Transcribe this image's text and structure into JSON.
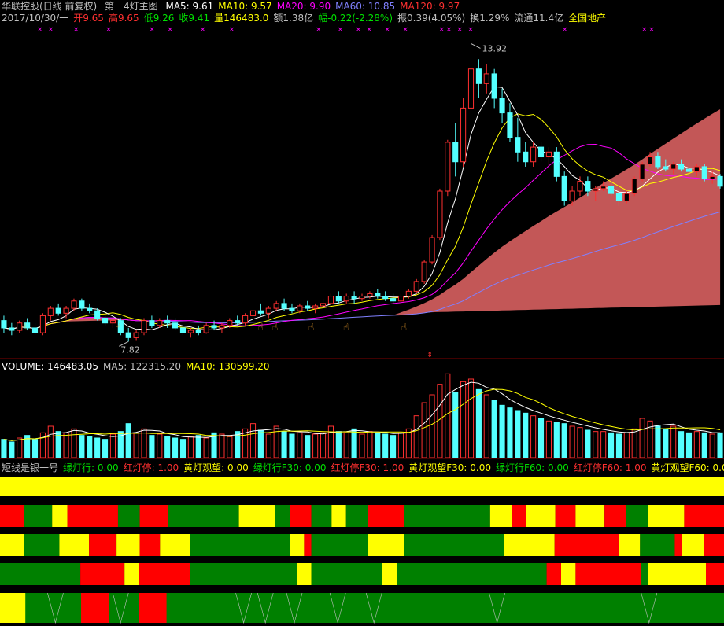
{
  "header": {
    "stock": "华联控股(日线 前复权)",
    "indicator": "第一4灯主图",
    "ma": [
      {
        "label": "MA5: 9.61",
        "color": "#ffffff"
      },
      {
        "label": "MA10: 9.57",
        "color": "#ffff00"
      },
      {
        "label": "MA20: 9.90",
        "color": "#ff00ff"
      },
      {
        "label": "MA60: 10.85",
        "color": "#8080ff"
      },
      {
        "label": "MA120: 9.97",
        "color": "#ff3030"
      }
    ],
    "quote": [
      {
        "label": "2017/10/30/一",
        "color": "#c0c0c0"
      },
      {
        "label": "开9.65",
        "color": "#ff3030"
      },
      {
        "label": "高9.65",
        "color": "#ff3030"
      },
      {
        "label": "低9.26",
        "color": "#00e000"
      },
      {
        "label": "收9.41",
        "color": "#00e000"
      },
      {
        "label": "量146483.0",
        "color": "#ffff00"
      },
      {
        "label": "额1.38亿",
        "color": "#c0c0c0"
      },
      {
        "label": "幅-0.22(-2.28%)",
        "color": "#00e000"
      },
      {
        "label": "振0.39(4.05%)",
        "color": "#c0c0c0"
      },
      {
        "label": "换1.29%",
        "color": "#c0c0c0"
      },
      {
        "label": "流通11.4亿",
        "color": "#c0c0c0"
      },
      {
        "label": "全国地产",
        "color": "#ffff00"
      }
    ]
  },
  "volume_header": [
    {
      "label": "VOLUME: 146483.05",
      "color": "#ffffff"
    },
    {
      "label": "MA5: 122315.20",
      "color": "#c0c0c0"
    },
    {
      "label": "MA10: 130599.20",
      "color": "#ffff00"
    }
  ],
  "signal_header": [
    {
      "label": "短线是银一号",
      "color": "#c0c0c0"
    },
    {
      "label": "绿灯行: 0.00",
      "color": "#00e000"
    },
    {
      "label": "红灯停: 1.00",
      "color": "#ff3030"
    },
    {
      "label": "黄灯观望: 0.00",
      "color": "#ffff00"
    },
    {
      "label": "绿灯行F30: 0.00",
      "color": "#00e000"
    },
    {
      "label": "红灯停F30: 1.00",
      "color": "#ff3030"
    },
    {
      "label": "黄灯观望F30: 0.00",
      "color": "#ffff00"
    },
    {
      "label": "绿灯行F60: 0.00",
      "color": "#00e000"
    },
    {
      "label": "红灯停F60: 1.00",
      "color": "#ff3030"
    },
    {
      "label": "黄灯观望F60: 0.00",
      "color": "#ffff00"
    }
  ],
  "annotations": {
    "high": "13.92",
    "low": "7.82"
  },
  "colors": {
    "up": "#ff3030",
    "down": "#54ffff",
    "green": "#008000",
    "red": "#ff0000",
    "yellow": "#ffff00",
    "band": "#cd5c5c",
    "grid": "#800000"
  },
  "chart_data": {
    "type": "candlestick",
    "price_range": [
      7.6,
      14.2
    ],
    "volume_max": 330000,
    "candles": [
      [
        8.25,
        8.35,
        8.0,
        8.1
      ],
      [
        8.1,
        8.2,
        7.95,
        8.05
      ],
      [
        8.05,
        8.25,
        8.0,
        8.2
      ],
      [
        8.2,
        8.3,
        8.05,
        8.1
      ],
      [
        8.1,
        8.2,
        7.95,
        8.0
      ],
      [
        8.0,
        8.4,
        7.95,
        8.35
      ],
      [
        8.35,
        8.55,
        8.25,
        8.5
      ],
      [
        8.5,
        8.6,
        8.35,
        8.4
      ],
      [
        8.4,
        8.55,
        8.3,
        8.5
      ],
      [
        8.5,
        8.7,
        8.45,
        8.65
      ],
      [
        8.65,
        8.7,
        8.45,
        8.5
      ],
      [
        8.5,
        8.6,
        8.4,
        8.45
      ],
      [
        8.45,
        8.5,
        8.25,
        8.3
      ],
      [
        8.3,
        8.35,
        8.15,
        8.2
      ],
      [
        8.2,
        8.3,
        8.1,
        8.25
      ],
      [
        8.25,
        8.3,
        7.95,
        8.0
      ],
      [
        8.0,
        8.1,
        7.82,
        7.9
      ],
      [
        7.9,
        8.05,
        7.85,
        8.0
      ],
      [
        8.0,
        8.3,
        7.95,
        8.25
      ],
      [
        8.25,
        8.35,
        8.1,
        8.15
      ],
      [
        8.15,
        8.3,
        8.1,
        8.25
      ],
      [
        8.25,
        8.35,
        8.1,
        8.2
      ],
      [
        8.2,
        8.3,
        8.05,
        8.1
      ],
      [
        8.1,
        8.15,
        7.95,
        8.0
      ],
      [
        8.0,
        8.1,
        7.9,
        8.05
      ],
      [
        8.05,
        8.15,
        7.95,
        8.0
      ],
      [
        8.0,
        8.2,
        7.98,
        8.15
      ],
      [
        8.15,
        8.25,
        8.05,
        8.1
      ],
      [
        8.1,
        8.2,
        8.0,
        8.15
      ],
      [
        8.15,
        8.3,
        8.1,
        8.25
      ],
      [
        8.25,
        8.35,
        8.15,
        8.2
      ],
      [
        8.2,
        8.4,
        8.15,
        8.35
      ],
      [
        8.35,
        8.5,
        8.3,
        8.45
      ],
      [
        8.45,
        8.6,
        8.35,
        8.4
      ],
      [
        8.4,
        8.55,
        8.3,
        8.5
      ],
      [
        8.5,
        8.65,
        8.45,
        8.6
      ],
      [
        8.6,
        8.7,
        8.45,
        8.5
      ],
      [
        8.5,
        8.6,
        8.4,
        8.45
      ],
      [
        8.45,
        8.6,
        8.4,
        8.55
      ],
      [
        8.55,
        8.65,
        8.45,
        8.5
      ],
      [
        8.5,
        8.6,
        8.4,
        8.55
      ],
      [
        8.55,
        8.7,
        8.5,
        8.6
      ],
      [
        8.6,
        8.8,
        8.55,
        8.75
      ],
      [
        8.75,
        8.85,
        8.6,
        8.65
      ],
      [
        8.65,
        8.8,
        8.6,
        8.75
      ],
      [
        8.75,
        8.85,
        8.6,
        8.7
      ],
      [
        8.7,
        8.8,
        8.65,
        8.75
      ],
      [
        8.75,
        8.85,
        8.7,
        8.8
      ],
      [
        8.8,
        8.9,
        8.7,
        8.75
      ],
      [
        8.75,
        8.85,
        8.65,
        8.7
      ],
      [
        8.7,
        8.8,
        8.6,
        8.65
      ],
      [
        8.65,
        8.8,
        8.62,
        8.75
      ],
      [
        8.75,
        8.9,
        8.7,
        8.85
      ],
      [
        8.85,
        9.1,
        8.8,
        9.05
      ],
      [
        9.05,
        9.5,
        9.0,
        9.45
      ],
      [
        9.45,
        10.0,
        9.4,
        9.95
      ],
      [
        9.95,
        10.95,
        9.9,
        10.9
      ],
      [
        10.9,
        11.95,
        10.8,
        11.9
      ],
      [
        11.9,
        12.3,
        11.2,
        11.5
      ],
      [
        11.5,
        12.8,
        11.4,
        12.6
      ],
      [
        12.6,
        13.92,
        12.4,
        13.4
      ],
      [
        13.4,
        13.6,
        12.8,
        13.1
      ],
      [
        13.1,
        13.5,
        12.9,
        13.3
      ],
      [
        13.3,
        13.4,
        12.6,
        12.8
      ],
      [
        12.8,
        13.0,
        12.3,
        12.5
      ],
      [
        12.5,
        12.7,
        11.9,
        12.0
      ],
      [
        12.0,
        12.4,
        11.5,
        11.7
      ],
      [
        11.7,
        11.9,
        11.4,
        11.5
      ],
      [
        11.5,
        11.9,
        11.4,
        11.8
      ],
      [
        11.8,
        11.9,
        11.5,
        11.6
      ],
      [
        11.6,
        11.8,
        11.4,
        11.7
      ],
      [
        11.7,
        11.8,
        11.1,
        11.2
      ],
      [
        11.2,
        11.3,
        10.6,
        10.7
      ],
      [
        10.7,
        11.0,
        10.6,
        10.9
      ],
      [
        10.9,
        11.2,
        10.8,
        11.1
      ],
      [
        11.1,
        11.2,
        10.8,
        10.9
      ],
      [
        10.9,
        11.0,
        10.7,
        10.95
      ],
      [
        10.95,
        11.1,
        10.9,
        11.0
      ],
      [
        11.0,
        11.1,
        10.8,
        10.85
      ],
      [
        10.85,
        10.95,
        10.6,
        10.7
      ],
      [
        10.7,
        10.9,
        10.65,
        10.85
      ],
      [
        10.85,
        11.2,
        10.8,
        11.15
      ],
      [
        11.15,
        11.5,
        11.1,
        11.45
      ],
      [
        11.45,
        11.7,
        11.4,
        11.6
      ],
      [
        11.6,
        11.7,
        11.35,
        11.4
      ],
      [
        11.4,
        11.55,
        11.3,
        11.35
      ],
      [
        11.35,
        11.5,
        11.25,
        11.45
      ],
      [
        11.45,
        11.55,
        11.3,
        11.35
      ],
      [
        11.35,
        11.5,
        11.2,
        11.3
      ],
      [
        11.3,
        11.45,
        11.2,
        11.4
      ],
      [
        11.4,
        11.45,
        11.1,
        11.15
      ],
      [
        11.15,
        11.3,
        11.05,
        11.2
      ],
      [
        11.2,
        11.25,
        10.95,
        11.0
      ]
    ],
    "volumes": [
      70,
      60,
      75,
      85,
      70,
      95,
      120,
      100,
      95,
      110,
      85,
      80,
      75,
      70,
      90,
      100,
      130,
      95,
      110,
      85,
      90,
      80,
      75,
      70,
      80,
      85,
      75,
      95,
      90,
      80,
      100,
      110,
      130,
      105,
      90,
      120,
      100,
      90,
      95,
      85,
      90,
      95,
      120,
      100,
      95,
      110,
      90,
      100,
      95,
      90,
      85,
      95,
      110,
      160,
      210,
      240,
      280,
      320,
      250,
      290,
      300,
      260,
      240,
      220,
      200,
      190,
      180,
      170,
      160,
      150,
      140,
      135,
      130,
      120,
      115,
      105,
      100,
      100,
      95,
      90,
      95,
      110,
      150,
      140,
      120,
      110,
      120,
      100,
      95,
      100,
      95,
      90,
      95
    ],
    "signal_rows": [
      [
        [
          "Y",
          0,
          1
        ]
      ],
      [
        [
          "R",
          0,
          0.033
        ],
        [
          "G",
          0.033,
          0.072
        ],
        [
          "Y",
          0.072,
          0.093
        ],
        [
          "R",
          0.093,
          0.163
        ],
        [
          "G",
          0.163,
          0.193
        ],
        [
          "R",
          0.193,
          0.232
        ],
        [
          "G",
          0.232,
          0.33
        ],
        [
          "Y",
          0.33,
          0.38
        ],
        [
          "G",
          0.38,
          0.4
        ],
        [
          "R",
          0.4,
          0.43
        ],
        [
          "G",
          0.43,
          0.458
        ],
        [
          "Y",
          0.458,
          0.478
        ],
        [
          "G",
          0.478,
          0.508
        ],
        [
          "R",
          0.508,
          0.558
        ],
        [
          "G",
          0.558,
          0.677
        ],
        [
          "Y",
          0.677,
          0.707
        ],
        [
          "R",
          0.707,
          0.727
        ],
        [
          "Y",
          0.727,
          0.767
        ],
        [
          "R",
          0.767,
          0.795
        ],
        [
          "Y",
          0.795,
          0.835
        ],
        [
          "R",
          0.835,
          0.865
        ],
        [
          "G",
          0.865,
          0.895
        ],
        [
          "Y",
          0.895,
          0.945
        ],
        [
          "R",
          0.945,
          1
        ]
      ],
      [
        [
          "Y",
          0,
          0.033
        ],
        [
          "G",
          0.033,
          0.082
        ],
        [
          "Y",
          0.082,
          0.123
        ],
        [
          "R",
          0.123,
          0.161
        ],
        [
          "Y",
          0.161,
          0.193
        ],
        [
          "R",
          0.193,
          0.221
        ],
        [
          "Y",
          0.221,
          0.262
        ],
        [
          "G",
          0.262,
          0.4
        ],
        [
          "Y",
          0.4,
          0.42
        ],
        [
          "R",
          0.42,
          0.43
        ],
        [
          "G",
          0.43,
          0.508
        ],
        [
          "Y",
          0.508,
          0.558
        ],
        [
          "G",
          0.558,
          0.696
        ],
        [
          "Y",
          0.696,
          0.766
        ],
        [
          "R",
          0.766,
          0.855
        ],
        [
          "Y",
          0.855,
          0.884
        ],
        [
          "G",
          0.884,
          0.932
        ],
        [
          "R",
          0.932,
          0.942
        ],
        [
          "Y",
          0.942,
          0.972
        ],
        [
          "R",
          0.972,
          1
        ]
      ],
      [
        [
          "G",
          0,
          0.111
        ],
        [
          "R",
          0.111,
          0.172
        ],
        [
          "Y",
          0.172,
          0.192
        ],
        [
          "R",
          0.192,
          0.262
        ],
        [
          "G",
          0.262,
          0.41
        ],
        [
          "Y",
          0.41,
          0.43
        ],
        [
          "G",
          0.43,
          0.528
        ],
        [
          "Y",
          0.528,
          0.548
        ],
        [
          "G",
          0.548,
          0.755
        ],
        [
          "R",
          0.755,
          0.775
        ],
        [
          "Y",
          0.775,
          0.795
        ],
        [
          "R",
          0.795,
          0.885
        ],
        [
          "G",
          0.885,
          0.895
        ],
        [
          "Y",
          0.895,
          0.975
        ],
        [
          "R",
          0.975,
          1
        ]
      ],
      [
        [
          "G",
          0,
          1
        ]
      ]
    ],
    "signal_bottom_red": [
      [
        0.112,
        0.15
      ],
      [
        0.192,
        0.23
      ]
    ],
    "signal_bottom_yellow": [
      [
        0.0,
        0.035
      ]
    ],
    "markers_top": [
      0.055,
      0.07,
      0.105,
      0.15,
      0.21,
      0.235,
      0.28,
      0.32,
      0.44,
      0.47,
      0.495,
      0.51,
      0.535,
      0.56,
      0.61,
      0.62,
      0.635,
      0.65,
      0.78,
      0.89,
      0.9
    ],
    "hand_markers": [
      0.033,
      0.163,
      0.36,
      0.38,
      0.43,
      0.478,
      0.558
    ]
  }
}
